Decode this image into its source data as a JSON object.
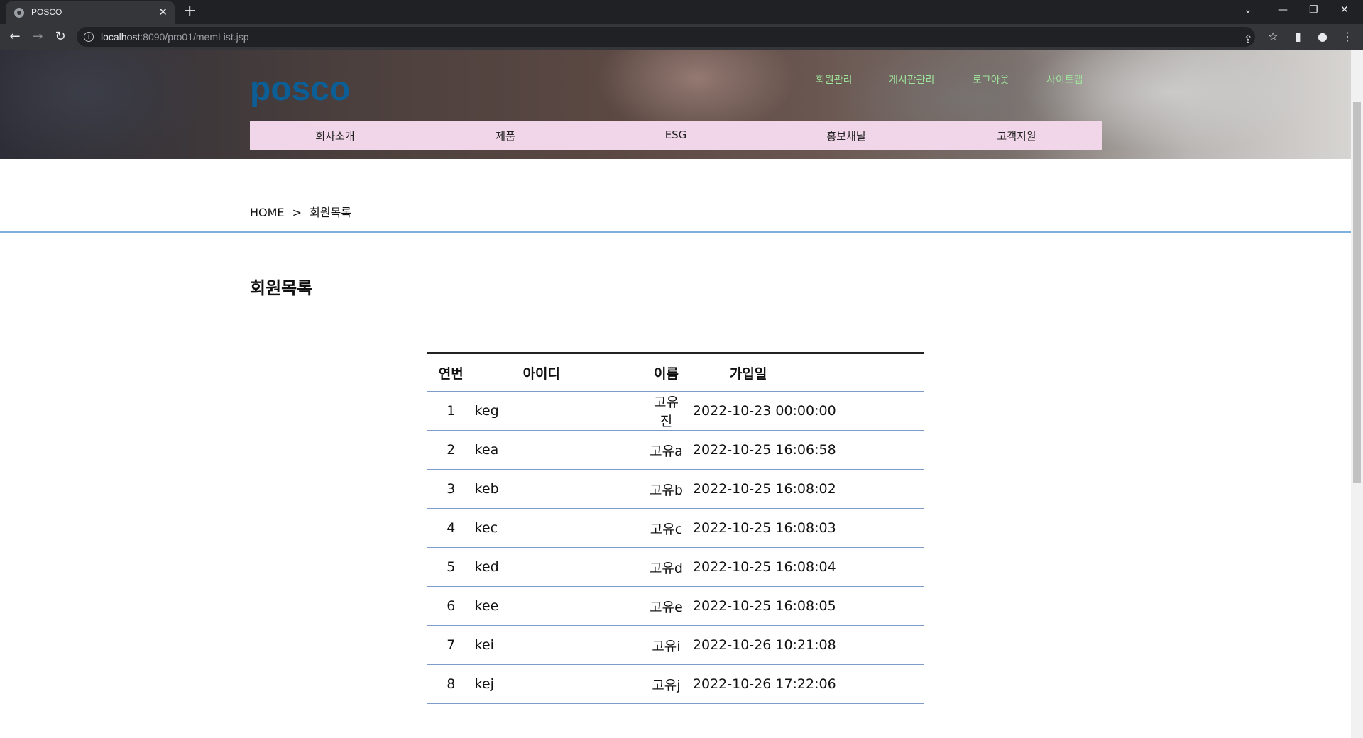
{
  "browser": {
    "tab_title": "POSCO",
    "url_host": "localhost",
    "url_rest": ":8090/pro01/memList.jsp"
  },
  "header": {
    "logo": "posco",
    "util_nav": [
      "회원관리",
      "게시판관리",
      "로그아웃",
      "사이트맵"
    ],
    "gnb": [
      "회사소개",
      "제품",
      "ESG",
      "홍보채널",
      "고객지원"
    ]
  },
  "breadcrumb": {
    "home": "HOME",
    "separator": ">",
    "current": "회원목록"
  },
  "main": {
    "title": "회원목록",
    "table": {
      "headers": [
        "연번",
        "아이디",
        "이름",
        "가입일"
      ],
      "rows": [
        {
          "no": "1",
          "id": "keg",
          "name": "고유진",
          "date": "2022-10-23 00:00:00"
        },
        {
          "no": "2",
          "id": "kea",
          "name": "고유a",
          "date": "2022-10-25 16:06:58"
        },
        {
          "no": "3",
          "id": "keb",
          "name": "고유b",
          "date": "2022-10-25 16:08:02"
        },
        {
          "no": "4",
          "id": "kec",
          "name": "고유c",
          "date": "2022-10-25 16:08:03"
        },
        {
          "no": "5",
          "id": "ked",
          "name": "고유d",
          "date": "2022-10-25 16:08:04"
        },
        {
          "no": "6",
          "id": "kee",
          "name": "고유e",
          "date": "2022-10-25 16:08:05"
        },
        {
          "no": "7",
          "id": "kei",
          "name": "고유i",
          "date": "2022-10-26 10:21:08"
        },
        {
          "no": "8",
          "id": "kej",
          "name": "고유j",
          "date": "2022-10-26 17:22:06"
        }
      ]
    }
  },
  "colors": {
    "gnb_bg": "#f0d6e8",
    "logo": "#0b5f96",
    "util_nav": "#9fe39a",
    "divider": "#7fb0e0",
    "row_border": "#7e9cc9"
  }
}
